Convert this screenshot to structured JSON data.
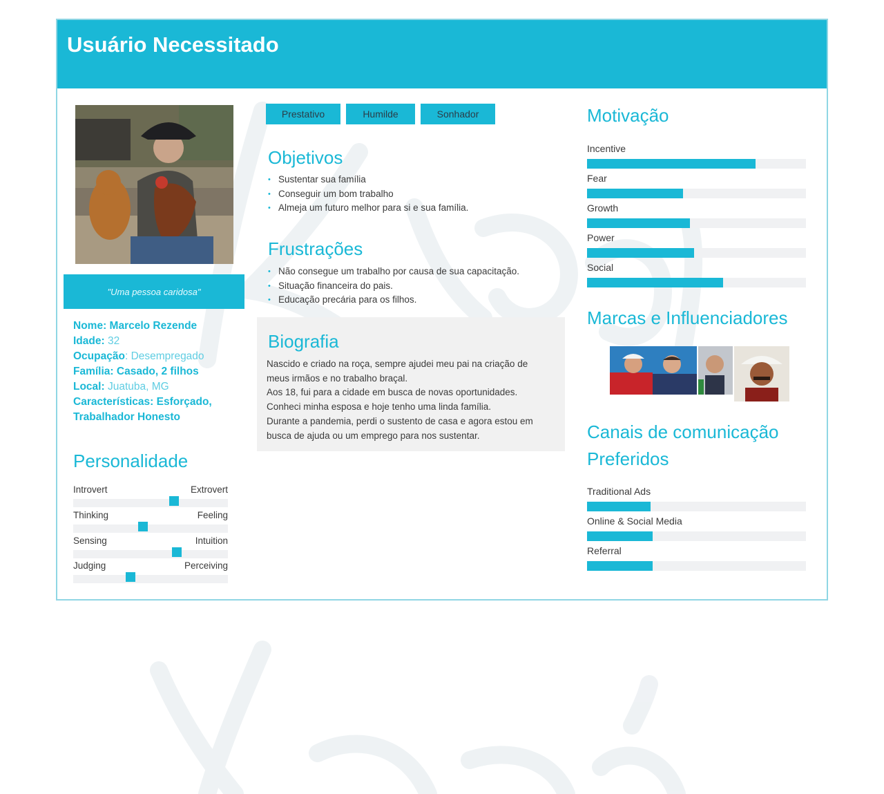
{
  "header": {
    "title": "Usuário Necessitado"
  },
  "profile": {
    "quote": "\"Uma pessoa caridosa\"",
    "fields": [
      {
        "key": "Nome: ",
        "value": "Marcelo Rezende",
        "bold_value": true
      },
      {
        "key": "Idade:",
        "value": " 32",
        "bold_value": false
      },
      {
        "key": "Ocupação",
        "value": ": Desempregado",
        "bold_value": false
      },
      {
        "key": "Família: ",
        "value": "Casado, 2 filhos",
        "bold_value": true
      },
      {
        "key": "Local:",
        "value": " Juatuba, MG",
        "bold_value": false
      },
      {
        "key": "Características: ",
        "value": "Esforçado, Trabalhador Honesto",
        "bold_value": true
      }
    ]
  },
  "personality": {
    "title": "Personalidade",
    "traits": [
      {
        "left": "Introvert",
        "right": "Extrovert",
        "position": 0.65
      },
      {
        "left": "Thinking",
        "right": "Feeling",
        "position": 0.45
      },
      {
        "left": "Sensing",
        "right": "Intuition",
        "position": 0.67
      },
      {
        "left": "Judging",
        "right": "Perceiving",
        "position": 0.37
      }
    ]
  },
  "tags": [
    "Prestativo",
    "Humilde",
    "Sonhador"
  ],
  "objectives": {
    "title": "Objetivos",
    "items": [
      "Sustentar sua família",
      "Conseguir um bom trabalho",
      "Almeja um futuro melhor para si e sua família."
    ]
  },
  "frustrations": {
    "title": "Frustrações",
    "items": [
      "Não consegue um trabalho por causa de sua capacitação.",
      "Situação financeira do pais.",
      "Educação precária para os filhos."
    ]
  },
  "biography": {
    "title": "Biografia",
    "lines": [
      "Nascido e criado na roça, sempre ajudei meu pai na criação de",
      "meus irmãos e no trabalho braçal.",
      "Aos 18, fui para a cidade em busca de novas oportunidades.",
      "Conheci minha esposa e hoje tenho uma linda família.",
      "Durante a pandemia, perdi o sustento  de casa e agora estou em",
      "busca de ajuda ou um emprego para nos sustentar."
    ]
  },
  "motivation": {
    "title": "Motivação",
    "bars": [
      {
        "label": "Incentive",
        "value": 0.77
      },
      {
        "label": "Fear",
        "value": 0.44
      },
      {
        "label": "Growth",
        "value": 0.47
      },
      {
        "label": "Power",
        "value": 0.49
      },
      {
        "label": "Social",
        "value": 0.62
      }
    ]
  },
  "brands": {
    "title": "Marcas e Influenciadores"
  },
  "channels": {
    "title_line1": "Canais de comunicação",
    "title_line2": "Preferidos",
    "bars": [
      {
        "label": "Traditional Ads",
        "value": 0.29
      },
      {
        "label": "Online & Social Media",
        "value": 0.3
      },
      {
        "label": "Referral",
        "value": 0.3
      }
    ]
  },
  "colors": {
    "accent": "#1ab8d6",
    "track": "#f0f1f3",
    "bio_bg": "#f1f1f1"
  }
}
